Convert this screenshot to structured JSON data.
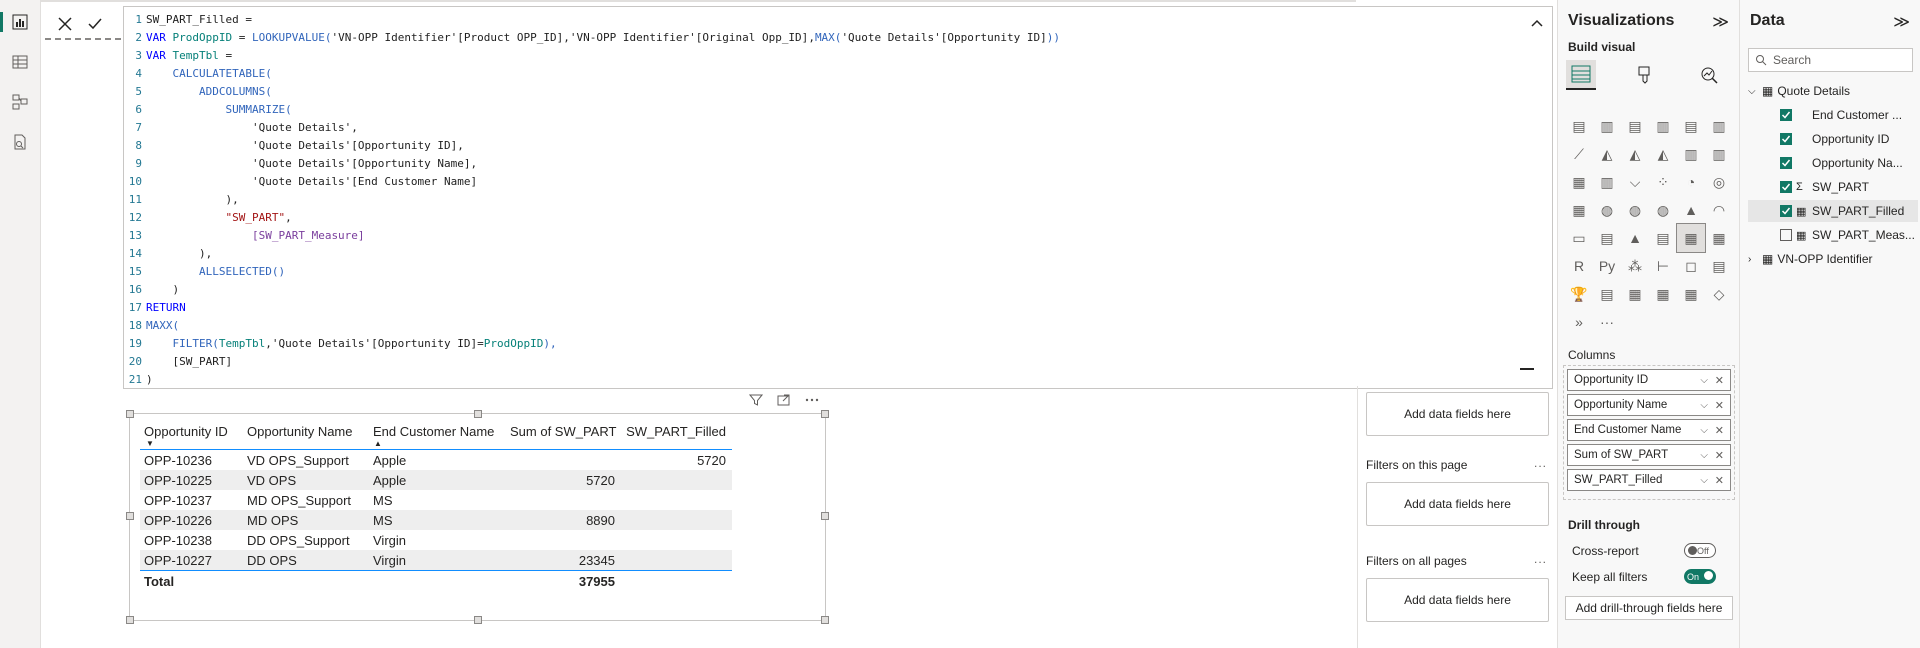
{
  "formula": {
    "lines": [
      [
        {
          "t": "SW_PART_Filled =",
          "c": "plain"
        }
      ],
      [
        {
          "t": "VAR ",
          "c": "kw"
        },
        {
          "t": "ProdOppID",
          "c": "var"
        },
        {
          "t": " = ",
          "c": "plain"
        },
        {
          "t": "LOOKUPVALUE(",
          "c": "fn"
        },
        {
          "t": "'VN-OPP Identifier'[Product OPP_ID]",
          "c": "ref"
        },
        {
          "t": ",",
          "c": "plain"
        },
        {
          "t": "'VN-OPP Identifier'[Original Opp_ID]",
          "c": "ref"
        },
        {
          "t": ",",
          "c": "plain"
        },
        {
          "t": "MAX(",
          "c": "fn"
        },
        {
          "t": "'Quote Details'[Opportunity ID]",
          "c": "ref"
        },
        {
          "t": "))",
          "c": "fn"
        }
      ],
      [
        {
          "t": "VAR ",
          "c": "kw"
        },
        {
          "t": "TempTbl",
          "c": "var"
        },
        {
          "t": " =",
          "c": "plain"
        }
      ],
      [
        {
          "t": "    CALCULATETABLE(",
          "c": "fn"
        }
      ],
      [
        {
          "t": "        ADDCOLUMNS(",
          "c": "fn"
        }
      ],
      [
        {
          "t": "            SUMMARIZE(",
          "c": "fn"
        }
      ],
      [
        {
          "t": "                'Quote Details',",
          "c": "ref"
        }
      ],
      [
        {
          "t": "                'Quote Details'[Opportunity ID],",
          "c": "ref"
        }
      ],
      [
        {
          "t": "                'Quote Details'[Opportunity Name],",
          "c": "ref"
        }
      ],
      [
        {
          "t": "                'Quote Details'[End Customer Name]",
          "c": "ref"
        }
      ],
      [
        {
          "t": "            ),",
          "c": "plain"
        }
      ],
      [
        {
          "t": "            ",
          "c": "plain"
        },
        {
          "t": "\"SW_PART\"",
          "c": "str"
        },
        {
          "t": ",",
          "c": "plain"
        }
      ],
      [
        {
          "t": "                ",
          "c": "plain"
        },
        {
          "t": "[SW_PART_Measure]",
          "c": "meas"
        }
      ],
      [
        {
          "t": "        ),",
          "c": "plain"
        }
      ],
      [
        {
          "t": "        ALLSELECTED()",
          "c": "fn"
        }
      ],
      [
        {
          "t": "    )",
          "c": "plain"
        }
      ],
      [
        {
          "t": "RETURN",
          "c": "kw"
        }
      ],
      [
        {
          "t": "MAXX(",
          "c": "fn"
        }
      ],
      [
        {
          "t": "    FILTER(",
          "c": "fn"
        },
        {
          "t": "TempTbl",
          "c": "var"
        },
        {
          "t": ",",
          "c": "plain"
        },
        {
          "t": "'Quote Details'[Opportunity ID]",
          "c": "ref"
        },
        {
          "t": "=",
          "c": "plain"
        },
        {
          "t": "ProdOppID",
          "c": "var"
        },
        {
          "t": "),",
          "c": "fn"
        }
      ],
      [
        {
          "t": "    [SW_PART]",
          "c": "ref"
        }
      ],
      [
        {
          "t": ")",
          "c": "plain"
        }
      ]
    ]
  },
  "table": {
    "headers": [
      "Opportunity ID",
      "Opportunity Name",
      "End Customer Name",
      "Sum of SW_PART",
      "SW_PART_Filled"
    ],
    "rows": [
      [
        "OPP-10236",
        "VD OPS_Support",
        "Apple",
        "",
        "5720"
      ],
      [
        "OPP-10225",
        "VD OPS",
        "Apple",
        "5720",
        ""
      ],
      [
        "OPP-10237",
        "MD OPS_Support",
        "MS",
        "",
        ""
      ],
      [
        "OPP-10226",
        "MD OPS",
        "MS",
        "8890",
        ""
      ],
      [
        "OPP-10238",
        "DD OPS_Support",
        "Virgin",
        "",
        ""
      ],
      [
        "OPP-10227",
        "DD OPS",
        "Virgin",
        "23345",
        ""
      ]
    ],
    "total": [
      "Total",
      "",
      "",
      "37955",
      ""
    ]
  },
  "filters": {
    "visual_box": "Add data fields here",
    "page_title": "Filters on this page",
    "page_box": "Add data fields here",
    "all_title": "Filters on all pages",
    "all_box": "Add data fields here",
    "more": "..."
  },
  "viz": {
    "title": "Visualizations",
    "collapse": "≫",
    "build_visual": "Build visual",
    "gallery_more": "···",
    "columns_label": "Columns",
    "columns": [
      "Opportunity ID",
      "Opportunity Name",
      "End Customer Name",
      "Sum of SW_PART",
      "SW_PART_Filled"
    ],
    "drill_title": "Drill through",
    "cross_report": "Cross-report",
    "cross_report_state": "Off",
    "keep_filters": "Keep all filters",
    "keep_filters_state": "On",
    "drill_add": "Add drill-through fields here"
  },
  "data_pane": {
    "title": "Data",
    "collapse": "≫",
    "search_placeholder": "Search",
    "tables": [
      {
        "name": "Quote Details",
        "fields": [
          {
            "name": "End Customer ...",
            "checked": true,
            "kind": ""
          },
          {
            "name": "Opportunity ID",
            "checked": true,
            "kind": ""
          },
          {
            "name": "Opportunity Na...",
            "checked": true,
            "kind": ""
          },
          {
            "name": "SW_PART",
            "checked": true,
            "kind": "Σ"
          },
          {
            "name": "SW_PART_Filled",
            "checked": true,
            "kind": "calc"
          },
          {
            "name": "SW_PART_Meas...",
            "checked": false,
            "kind": "calc"
          }
        ]
      },
      {
        "name": "VN-OPP Identifier",
        "fields": []
      }
    ]
  },
  "colors": {
    "accent": "#117865",
    "table_rule": "#118dff",
    "zebra": "#eeeeee"
  }
}
